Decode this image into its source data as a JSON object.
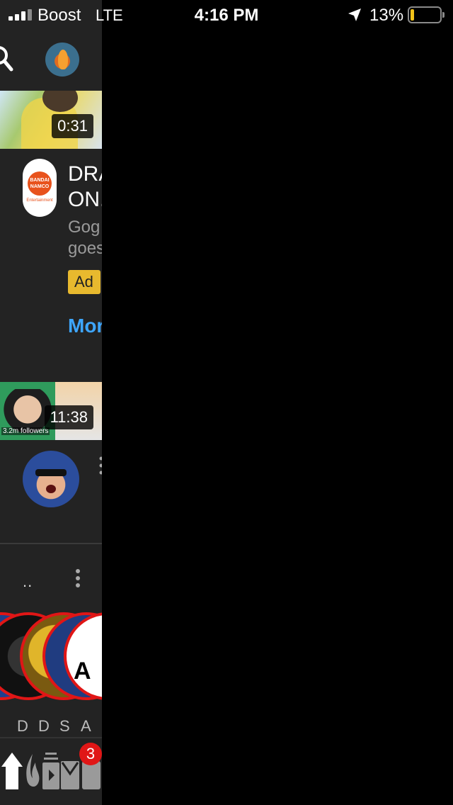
{
  "status_bar": {
    "carrier": "Boost",
    "network": "LTE",
    "time": "4:16 PM",
    "battery_percent": "13%",
    "battery_level": 0.13,
    "battery_color": "#f4c31a"
  },
  "feed": {
    "video1": {
      "duration": "0:31"
    },
    "ad": {
      "advertiser_logo_text": "BANDAI NAMCO",
      "advertiser_logo_sub": "Entertainment",
      "title_visible": "DRA\nON.",
      "description_visible": "Gog\ngoes",
      "badge": "Ad",
      "more_visible": "Mor"
    },
    "video2": {
      "duration": "11:38",
      "thumbnail_caption": "3.2m followers"
    }
  },
  "section": {
    "dots_text": ".."
  },
  "channels": {
    "tag_text": "#D",
    "letters": [
      "D",
      "D",
      "S",
      "A"
    ],
    "last_logo_text": "A"
  },
  "tab_bar": {
    "inbox_badge": "3"
  },
  "colors": {
    "panel_bg": "#232323",
    "link_blue": "#3ea6ff",
    "ad_badge": "#e8b92e",
    "badge_red": "#e01616"
  }
}
